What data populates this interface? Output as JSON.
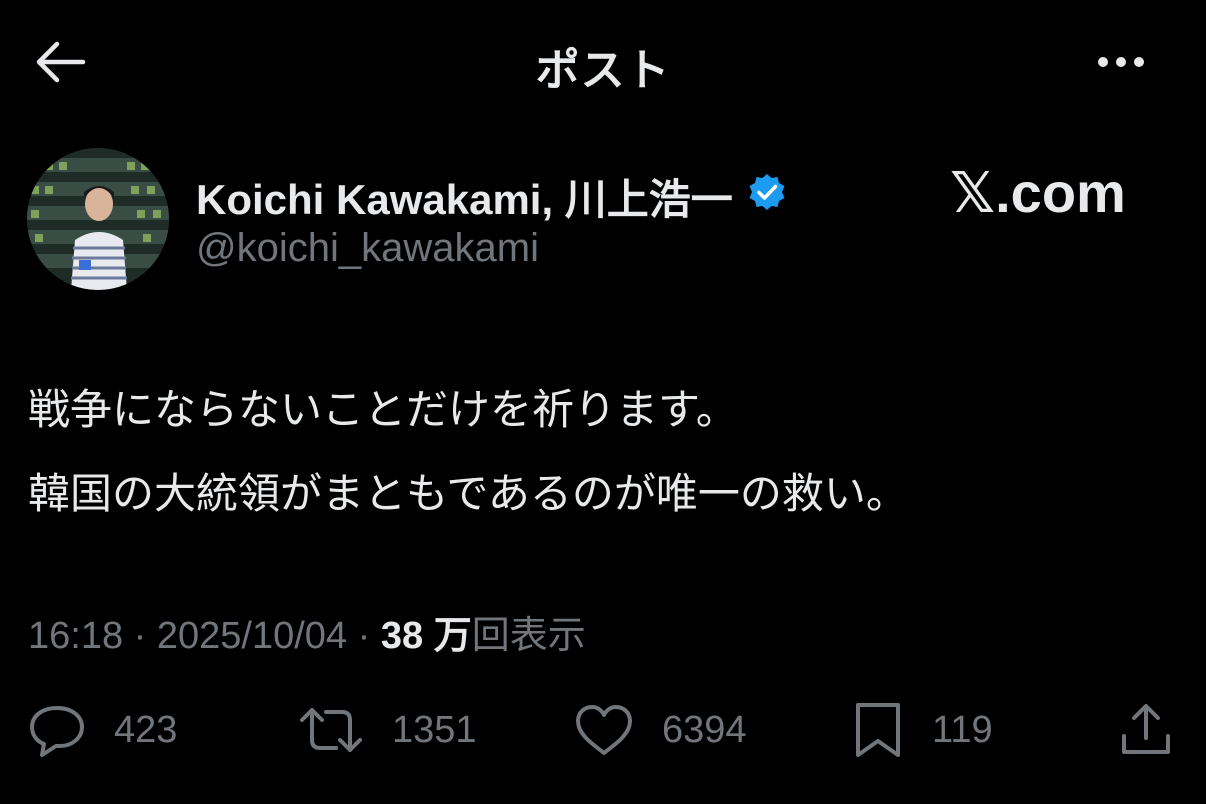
{
  "header": {
    "title": "ポスト",
    "back_icon": "arrow-left-icon",
    "more_icon": "more-horizontal-icon"
  },
  "author": {
    "display_name": "Koichi Kawakami, 川上浩一",
    "handle": "@koichi_kawakami",
    "verified": true,
    "verified_color": "#1d9bf0"
  },
  "watermark": "𝕏.com",
  "tweet": {
    "lines": [
      "戦争にならないことだけを祈ります。",
      "韓国の大統領がまともであるのが唯一の救い。"
    ]
  },
  "meta": {
    "time": "16:18",
    "separator": "·",
    "date": "2025/10/04",
    "views_number": "38",
    "views_unit": "万",
    "views_label": "回表示"
  },
  "actions": {
    "replies": "423",
    "retweets": "1351",
    "likes": "6394",
    "bookmarks": "119"
  },
  "colors": {
    "background": "#000000",
    "primary_text": "#e7e9ea",
    "secondary_text": "#71767b"
  }
}
